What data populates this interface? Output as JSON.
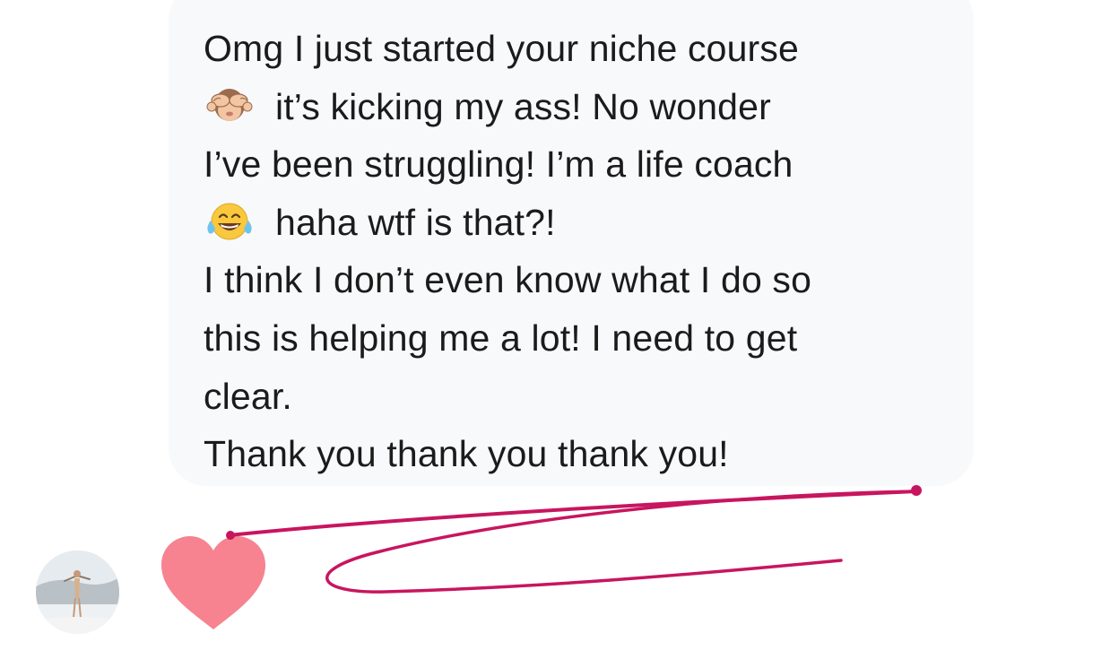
{
  "message": {
    "line1": "Omg I just started your niche course",
    "line2": "it’s kicking my ass! No wonder",
    "line3": "I’ve been struggling! I’m a life coach",
    "line4": "haha wtf is that?!",
    "line5": "I think I don’t even know what I do so",
    "line6": "this is helping me a lot! I need to get",
    "line7": "clear.",
    "line8": "Thank you thank you thank you!",
    "emojis": [
      "see-no-evil-monkey-icon",
      "tears-of-joy-icon"
    ]
  },
  "reaction": {
    "icon": "heart-icon",
    "color": "#f6838f"
  },
  "annotation": {
    "icon": "pen-underline-icon",
    "color": "#c8155f"
  },
  "colors": {
    "bubble": "#f8f9fb",
    "text": "#1b1b1b",
    "background": "#ffffff"
  }
}
